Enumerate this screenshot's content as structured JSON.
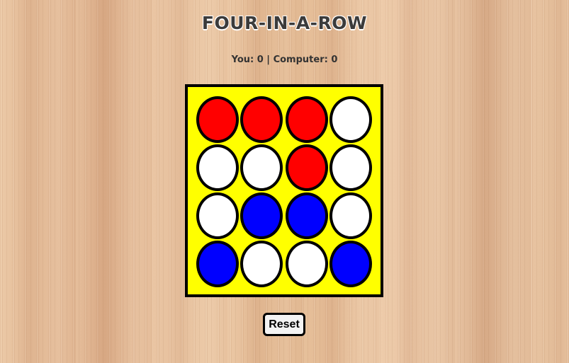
{
  "title": "FOUR-IN-A-ROW",
  "score": {
    "text": "You: 0 | Computer: 0",
    "you": 0,
    "computer": 0
  },
  "board": {
    "rows": 4,
    "cols": 4,
    "cells": [
      [
        "red",
        "red",
        "red",
        "empty"
      ],
      [
        "empty",
        "empty",
        "red",
        "empty"
      ],
      [
        "empty",
        "blue",
        "blue",
        "empty"
      ],
      [
        "blue",
        "empty",
        "empty",
        "blue"
      ]
    ]
  },
  "colors": {
    "red": "#ff0000",
    "blue": "#0000ff",
    "empty": "#ffffff",
    "board": "#ffff00"
  },
  "reset_label": "Reset"
}
